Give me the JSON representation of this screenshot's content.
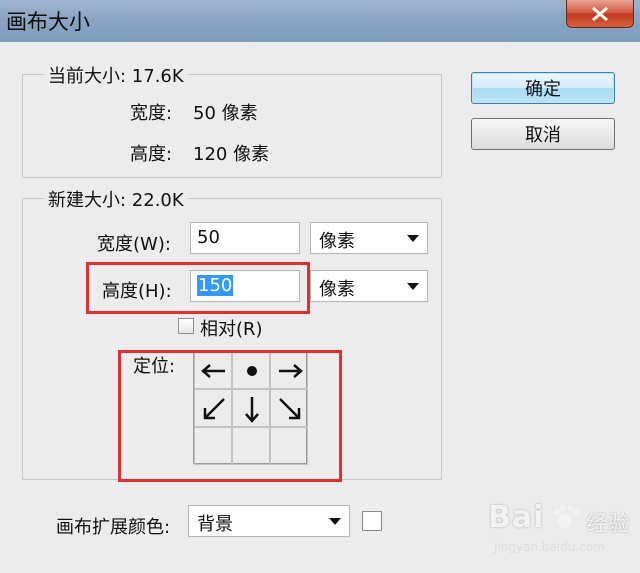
{
  "window": {
    "title": "画布大小"
  },
  "buttons": {
    "ok": "确定",
    "cancel": "取消"
  },
  "current_size": {
    "legend": "当前大小: 17.6K",
    "width_label": "宽度:",
    "width_value": "50 像素",
    "height_label": "高度:",
    "height_value": "120 像素"
  },
  "new_size": {
    "legend": "新建大小: 22.0K",
    "width_label": "宽度(W):",
    "width_value": "50",
    "width_unit": "像素",
    "height_label": "高度(H):",
    "height_value": "150",
    "height_unit": "像素",
    "relative_label": "相对(R)",
    "relative_checked": false,
    "anchor_label": "定位:"
  },
  "anchor": {
    "cells": [
      "arrow-left",
      "dot",
      "arrow-right",
      "arrow-down-left",
      "arrow-down",
      "arrow-down-right",
      "",
      "",
      ""
    ]
  },
  "extension_color": {
    "label": "画布扩展颜色:",
    "value": "背景",
    "swatch": "#ffffff"
  },
  "watermark": {
    "brand": "Bai",
    "product": "经验",
    "url": "jingyan.baidu.com"
  },
  "colors": {
    "highlight": "#e0302f",
    "title_bar": "#8aa5c2",
    "selection": "#3399ff"
  }
}
